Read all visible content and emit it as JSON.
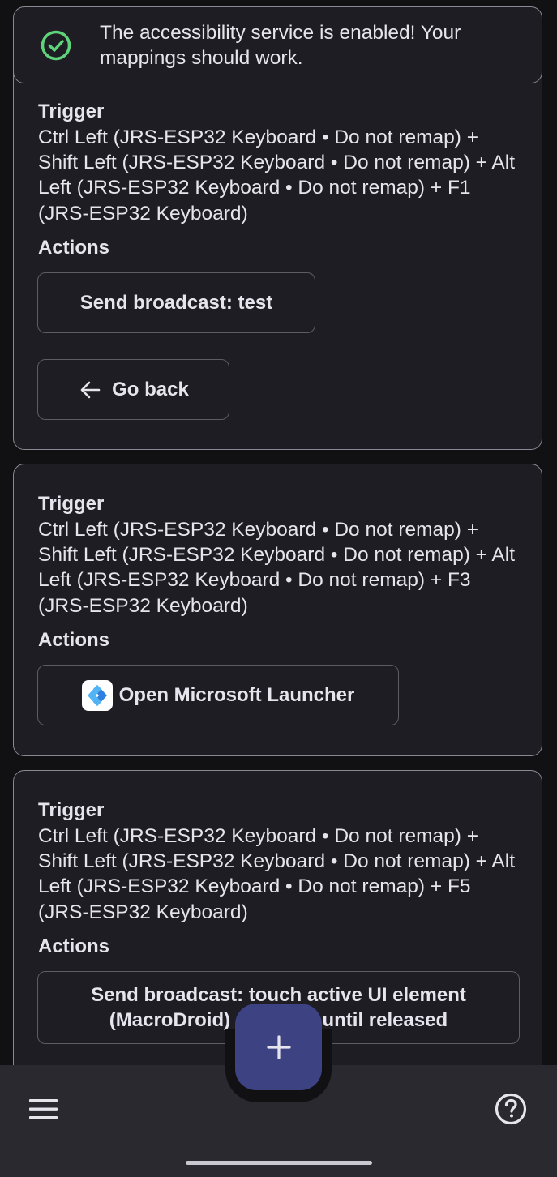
{
  "banner": {
    "message": "The accessibility service is enabled! Your mappings should work.",
    "icon": "check-circle-icon",
    "icon_color": "#5fd37a"
  },
  "mappings": [
    {
      "trigger_label": "Trigger",
      "trigger": "Ctrl Left (JRS-ESP32 Keyboard • Do not remap) + Shift Left (JRS-ESP32 Keyboard • Do not remap) + Alt Left (JRS-ESP32 Keyboard • Do not remap) + F1 (JRS-ESP32 Keyboard)",
      "actions_label": "Actions",
      "actions": [
        "Send broadcast: test",
        "Go back"
      ]
    },
    {
      "trigger_label": "Trigger",
      "trigger": "Ctrl Left (JRS-ESP32 Keyboard • Do not remap) + Shift Left (JRS-ESP32 Keyboard • Do not remap) + Alt Left (JRS-ESP32 Keyboard • Do not remap) + F3 (JRS-ESP32 Keyboard)",
      "actions_label": "Actions",
      "actions": [
        "Open Microsoft Launcher"
      ]
    },
    {
      "trigger_label": "Trigger",
      "trigger": "Ctrl Left (JRS-ESP32 Keyboard • Do not remap) + Shift Left (JRS-ESP32 Keyboard • Do not remap) + Alt Left (JRS-ESP32 Keyboard • Do not remap) + F5 (JRS-ESP32 Keyboard)",
      "actions_label": "Actions",
      "actions": [
        "Send broadcast: touch active UI element (MacroDroid)                 until released"
      ]
    }
  ],
  "fab": {
    "icon": "plus-icon"
  },
  "bottom_bar": {
    "menu_icon": "menu-icon",
    "help_icon": "help-icon"
  },
  "colors": {
    "background": "#111114",
    "card": "#1e1d23",
    "fab": "#3d4283",
    "bottom_bar": "#2a2930"
  }
}
